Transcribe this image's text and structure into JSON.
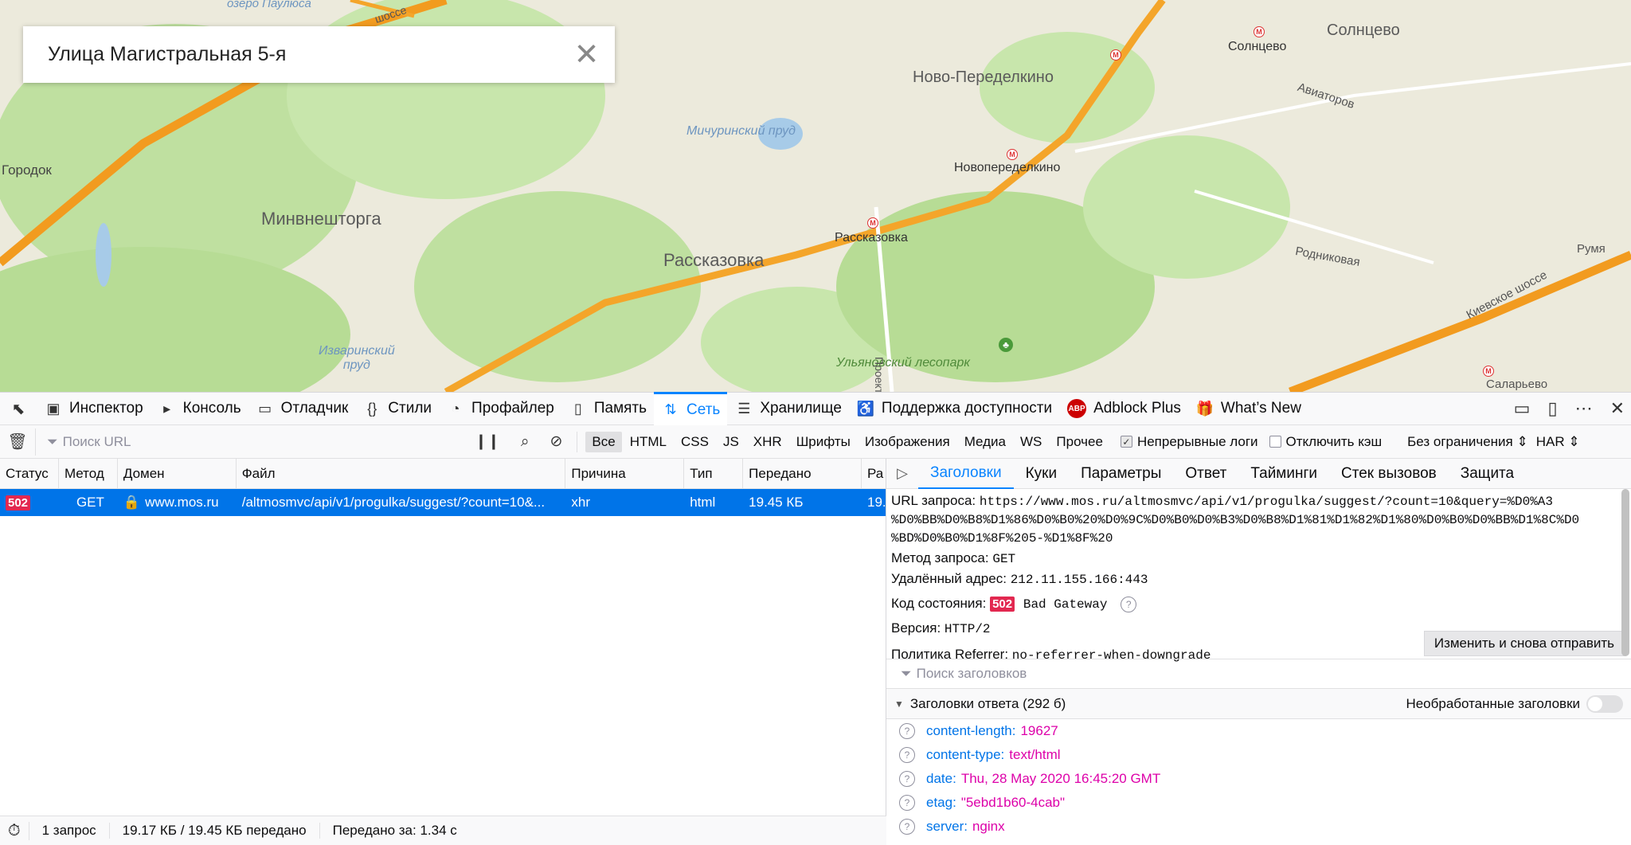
{
  "map": {
    "search_value": "Улица Магистральная 5-я",
    "labels": {
      "gorodok": "Городок",
      "minvneshtorga": "Минвнешторга",
      "rasskazovka": "Рассказовка",
      "rasskazovka_metro": "Рассказовка",
      "novo_peredelkino": "Ново-Переделкино",
      "novoperedelkino": "Новопеределкино",
      "solntsevo_metro": "Солнцево",
      "solntsevo": "Солнцево",
      "aviatorov": "Авиаторов",
      "rodnikovaya": "Родниковая",
      "kievskoe": "Киевское шоссе",
      "salaryevo": "Саларьево",
      "ruma": "Румя",
      "michurinsky": "Мичуринский пруд",
      "izvarinsky": "Изваринский\nпруд",
      "ozero": "озеро Паулюса",
      "shosse": "шоссе",
      "ulyanovsky": "Ульяновский лесопарк",
      "proekt": "Проект"
    }
  },
  "devtools": {
    "tabs": [
      {
        "label": "Инспектор",
        "icon": "inspector-icon"
      },
      {
        "label": "Консоль",
        "icon": "console-icon"
      },
      {
        "label": "Отладчик",
        "icon": "debugger-icon"
      },
      {
        "label": "Стили",
        "icon": "styles-icon"
      },
      {
        "label": "Профайлер",
        "icon": "profiler-icon"
      },
      {
        "label": "Память",
        "icon": "memory-icon"
      },
      {
        "label": "Сеть",
        "icon": "network-icon"
      },
      {
        "label": "Хранилище",
        "icon": "storage-icon"
      },
      {
        "label": "Поддержка доступности",
        "icon": "accessibility-icon"
      },
      {
        "label": "Adblock Plus",
        "icon": "abp-icon"
      },
      {
        "label": "What’s New",
        "icon": "gift-icon"
      }
    ],
    "active_tab": "Сеть",
    "filter": {
      "placeholder": "Поиск URL",
      "types": [
        "Все",
        "HTML",
        "CSS",
        "JS",
        "XHR",
        "Шрифты",
        "Изображения",
        "Медиа",
        "WS",
        "Прочее"
      ],
      "persist_logs": "Непрерывные логи",
      "disable_cache": "Отключить кэш",
      "throttle": "Без ограничения ⇕",
      "har": "HAR ⇕"
    },
    "columns": [
      "Статус",
      "Метод",
      "Домен",
      "Файл",
      "Причина",
      "Тип",
      "Передано",
      "Ра"
    ],
    "request": {
      "status": "502",
      "method": "GET",
      "domain": "www.mos.ru",
      "file": "/altmosmvc/api/v1/progulka/suggest/?count=10&...",
      "cause": "xhr",
      "type": "html",
      "transferred": "19.45 КБ",
      "size": "19."
    },
    "details": {
      "tabs": [
        "Заголовки",
        "Куки",
        "Параметры",
        "Ответ",
        "Тайминги",
        "Стек вызовов",
        "Защита"
      ],
      "url_label": "URL запроса:",
      "url_value": "https://www.mos.ru/altmosmvc/api/v1/progulka/suggest/?count=10&query=%D0%A3",
      "url_value2": "%D0%BB%D0%B8%D1%86%D0%B0%20%D0%9C%D0%B0%D0%B3%D0%B8%D1%81%D1%82%D1%80%D0%B0%D0%BB%D1%8C%D0",
      "url_value3": "%BD%D0%B0%D1%8F%205-%D1%8F%20",
      "method_label": "Метод запроса:",
      "method_value": "GET",
      "remote_label": "Удалённый адрес:",
      "remote_value": "212.11.155.166:443",
      "status_label": "Код состояния:",
      "status_code": "502",
      "status_text": "Bad Gateway",
      "version_label": "Версия:",
      "version_value": "HTTP/2",
      "referrer_label": "Политика Referrer:",
      "referrer_value": "no-referrer-when-downgrade",
      "resend": "Изменить и снова отправить",
      "header_search": "Поиск заголовков",
      "response_headers": "Заголовки ответа (292 б)",
      "raw_headers": "Необработанные заголовки",
      "headers": [
        {
          "name": "content-length:",
          "value": "19627"
        },
        {
          "name": "content-type:",
          "value": "text/html"
        },
        {
          "name": "date:",
          "value": "Thu, 28 May 2020 16:45:20 GMT"
        },
        {
          "name": "etag:",
          "value": "\"5ebd1b60-4cab\""
        },
        {
          "name": "server:",
          "value": "nginx"
        }
      ]
    },
    "statusbar": {
      "requests": "1 запрос",
      "size": "19.17 КБ / 19.45 КБ передано",
      "finish": "Передано за: 1.34 с"
    }
  }
}
